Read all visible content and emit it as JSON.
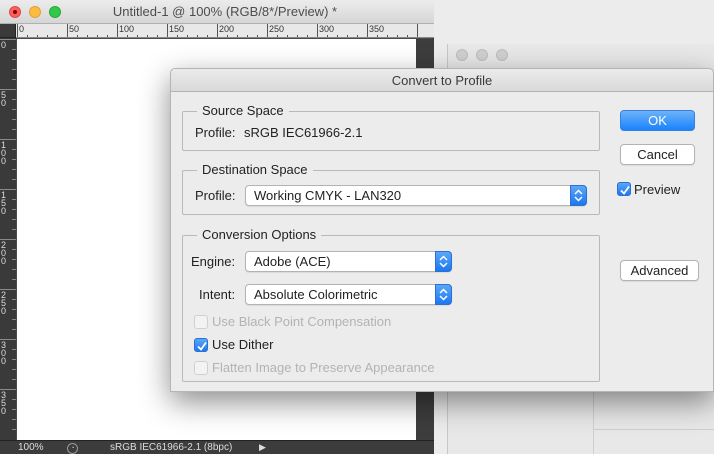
{
  "document_window": {
    "title": "Untitled-1 @ 100% (RGB/8*/Preview) *",
    "ruler_top_labels": [
      "0",
      "50",
      "100",
      "150",
      "200",
      "250",
      "300",
      "350"
    ],
    "ruler_left_labels": [
      "0",
      "50",
      "100",
      "150",
      "200",
      "250",
      "300",
      "350"
    ],
    "status": {
      "zoom": "100%",
      "profile": "sRGB IEC61966-2.1 (8bpc)",
      "arrow": "▶"
    }
  },
  "dialog": {
    "title": "Convert to Profile",
    "source_space": {
      "group_title": "Source Space",
      "profile_label": "Profile:",
      "profile_value": "sRGB IEC61966-2.1"
    },
    "destination_space": {
      "group_title": "Destination Space",
      "profile_label": "Profile:",
      "profile_value": "Working CMYK - LAN320"
    },
    "conversion_options": {
      "group_title": "Conversion Options",
      "engine_label": "Engine:",
      "engine_value": "Adobe (ACE)",
      "intent_label": "Intent:",
      "intent_value": "Absolute Colorimetric",
      "black_point": {
        "label": "Use Black Point Compensation",
        "checked": false,
        "enabled": false
      },
      "dither": {
        "label": "Use Dither",
        "checked": true,
        "enabled": true
      },
      "flatten": {
        "label": "Flatten Image to Preserve Appearance",
        "checked": false,
        "enabled": false
      }
    },
    "buttons": {
      "ok": "OK",
      "cancel": "Cancel",
      "advanced": "Advanced"
    },
    "preview": {
      "label": "Preview",
      "checked": true
    }
  },
  "colors": {
    "accent": "#1a82fb",
    "close": "#fc605c",
    "minimize": "#fdbc40",
    "maximize": "#34c84a"
  }
}
